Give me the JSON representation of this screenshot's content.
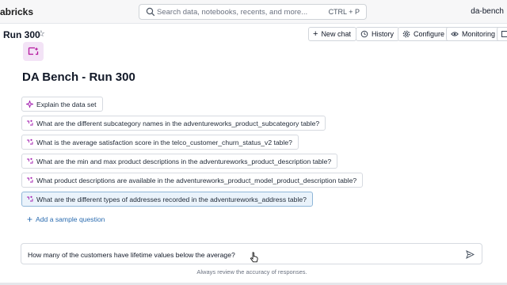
{
  "topbar": {
    "brand": "abricks",
    "search_placeholder": "Search data, notebooks, recents, and more...",
    "search_shortcut": "CTRL + P",
    "user": "da-bench"
  },
  "header": {
    "title": "Run 300",
    "buttons": {
      "new_chat": "New chat",
      "history": "History",
      "configure": "Configure",
      "monitoring": "Monitoring"
    }
  },
  "main": {
    "space_title": "DA Bench - Run 300",
    "samples": [
      "Explain the data set",
      "What are the different subcategory names in the adventureworks_product_subcategory table?",
      "What is the average satisfaction score in the telco_customer_churn_status_v2 table?",
      "What are the min and max product descriptions in the adventureworks_product_description table?",
      "What product descriptions are available in the adventureworks_product_model_product_description table?",
      "What are the different types of addresses recorded in the adventureworks_address table?"
    ],
    "add_sample": "Add a sample question"
  },
  "chat": {
    "input_value": "How many of the customers have lifetime values below the average?",
    "disclaimer": "Always review the accuracy of responses."
  },
  "icons": {
    "search": "search-icon",
    "star": "star-icon",
    "sparkle": "sparkle-icon",
    "sample_question": "sample-question-icon",
    "send": "send-icon"
  },
  "colors": {
    "accent": "#2b6cb0",
    "active_sample_bg": "#eaf3fb",
    "logo_tile_bg": "#f3e3f6",
    "logo_icon": "#b5179e"
  }
}
